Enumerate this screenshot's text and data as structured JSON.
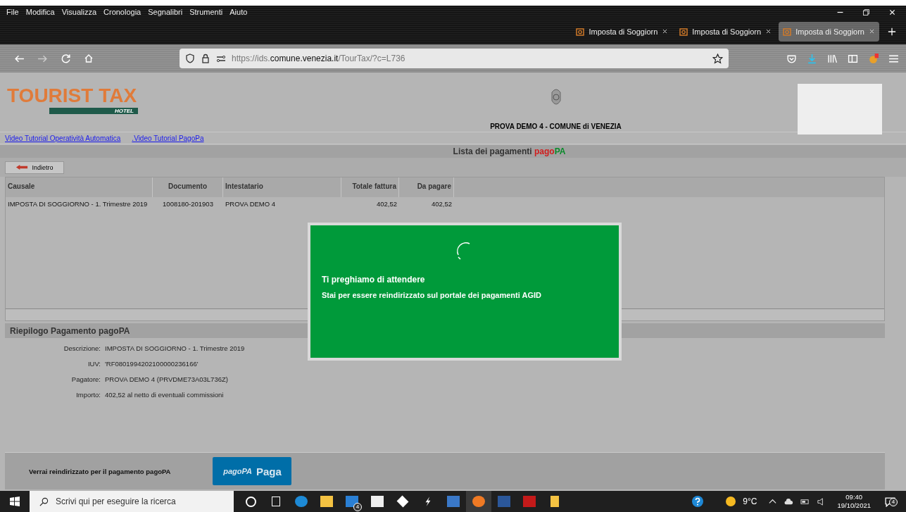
{
  "menu": [
    "File",
    "Modifica",
    "Visualizza",
    "Cronologia",
    "Segnalibri",
    "Strumenti",
    "Aiuto"
  ],
  "tabs": [
    {
      "title": "Imposta di Soggiorn",
      "selected": false
    },
    {
      "title": "Imposta di Soggiorn",
      "selected": false
    },
    {
      "title": "Imposta di Soggiorn",
      "selected": true
    }
  ],
  "address": {
    "scheme": "https://ids.",
    "domain": "comune.venezia.it",
    "path": "/TourTax/?c=L736"
  },
  "page": {
    "logo": {
      "title": "TOURIST TAX",
      "subtitle": "HOTEL"
    },
    "org_title": "PROVA DEMO 4 - COMUNE di VENEZIA",
    "links": [
      "Video Tutorial Operatività Automatica",
      ".Video Tutorial PagoPa"
    ],
    "list_title": {
      "text": "Lista dei pagamenti",
      "brand_red": "pago",
      "brand_green": "PA"
    },
    "back_button": "Indietro",
    "table": {
      "columns": [
        "Causale",
        "Documento",
        "Intestatario",
        "Totale fattura",
        "Da pagare"
      ],
      "rows": [
        [
          "IMPOSTA DI SOGGIORNO - 1. Trimestre 2019",
          "1008180-201903",
          "PROVA DEMO 4",
          "402,52",
          "402,52"
        ]
      ]
    },
    "summary": {
      "title": "Riepilogo Pagamento pagoPA",
      "fields": [
        {
          "label": "Descrizione:",
          "value": "IMPOSTA DI SOGGIORNO - 1. Trimestre 2019"
        },
        {
          "label": "IUV:",
          "value": "'RF0801994202100000236166'"
        },
        {
          "label": "Pagatore:",
          "value": "PROVA DEMO 4 (PRVDME73A03L736Z)"
        },
        {
          "label": "Importo:",
          "value": "402,52 al netto di eventuali commissioni"
        }
      ]
    },
    "footer": {
      "text": "Verrai reindirizzato per il pagamento pagoPA",
      "pay_logo": "pagoPA",
      "pay_button": "Paga"
    },
    "dialog": {
      "title": "Ti preghiamo di attendere",
      "message": "Stai per essere reindirizzato sul portale dei pagamenti AGID"
    }
  },
  "taskbar": {
    "search_placeholder": "Scrivi qui per eseguire la ricerca",
    "mail_badge": "4",
    "temperature": "9°C",
    "time": "09:40",
    "date": "19/10/2021",
    "notification_badge": "4"
  }
}
